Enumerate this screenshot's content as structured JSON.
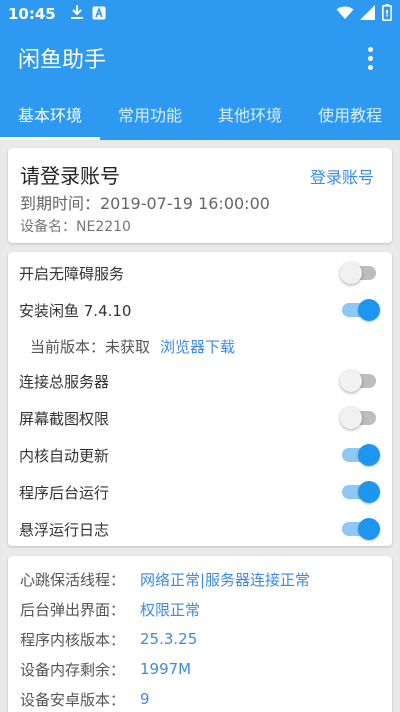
{
  "status_bar": {
    "time": "10:45",
    "icons": [
      "download-icon",
      "a-notification-icon",
      "wifi-icon",
      "signal-icon",
      "battery-icon"
    ]
  },
  "app_bar": {
    "title": "闲鱼助手",
    "menu_icon": "more-vert-icon"
  },
  "tabs": [
    {
      "label": "基本环境",
      "active": true
    },
    {
      "label": "常用功能",
      "active": false
    },
    {
      "label": "其他环境",
      "active": false
    },
    {
      "label": "使用教程",
      "active": false
    }
  ],
  "account": {
    "title": "请登录账号",
    "login_link": "登录账号",
    "expire": "到期时间：2019-07-19 16:00:00",
    "device": "设备名：NE2210"
  },
  "settings": {
    "accessibility": {
      "label": "开启无障碍服务",
      "on": false
    },
    "install": {
      "label": "安装闲鱼 7.4.10",
      "on": true
    },
    "current_version": {
      "label": "当前版本：未获取",
      "link": "浏览器下载"
    },
    "connect_server": {
      "label": "连接总服务器",
      "on": false
    },
    "screenshot": {
      "label": "屏幕截图权限",
      "on": false
    },
    "auto_update": {
      "label": "内核自动更新",
      "on": true
    },
    "background_run": {
      "label": "程序后台运行",
      "on": true
    },
    "float_log": {
      "label": "悬浮运行日志",
      "on": true
    }
  },
  "info": {
    "heartbeat": {
      "key": "心跳保活线程：",
      "value": "网络正常|服务器连接正常"
    },
    "popup": {
      "key": "后台弹出界面：",
      "value": "权限正常"
    },
    "kernel": {
      "key": "程序内核版本：",
      "value": "25.3.25"
    },
    "memory": {
      "key": "设备内存剩余：",
      "value": "1997M"
    },
    "android": {
      "key": "设备安卓版本：",
      "value": "9"
    }
  },
  "colors": {
    "primary": "#2e99f0",
    "accent": "#1e96f0",
    "link": "#3c8ae6"
  }
}
